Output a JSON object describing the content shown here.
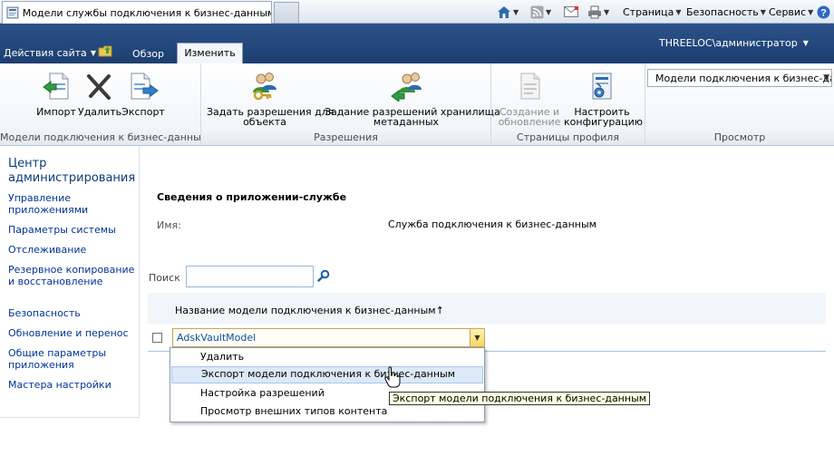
{
  "browser": {
    "tab_title": "Модели службы подключения к бизнес-данным",
    "commands": {
      "page": "Страница",
      "safety": "Безопасность",
      "service": "Сервис"
    }
  },
  "ribbon": {
    "site_actions": "Действия сайта",
    "tabs": {
      "browse": "Обзор",
      "edit": "Изменить"
    },
    "user": "THREELOC\\администратор",
    "groups": {
      "models": {
        "label": "Модели подключения к бизнес-данным",
        "import": "Импорт",
        "delete": "Удалить",
        "export": "Экспорт"
      },
      "permissions": {
        "label": "Разрешения",
        "set_object_line1": "Задать разрешения для",
        "set_object_line2": "объекта",
        "set_store_line1": "Задание разрешений хранилища",
        "set_store_line2": "метаданных"
      },
      "profile_pages": {
        "label": "Страницы профиля",
        "create_line1": "Создание и",
        "create_line2": "обновление",
        "configure_line1": "Настроить",
        "configure_line2": "конфигурацию"
      },
      "view": {
        "label": "Просмотр",
        "selected": "Модели подключения к бизнес-да"
      }
    }
  },
  "leftnav": {
    "title": "Центр администрирования",
    "items": [
      "Управление приложениями",
      "Параметры системы",
      "Отслеживание",
      "Резервное копирование и восстановление",
      "Безопасность",
      "Обновление и перенос",
      "Общие параметры приложения",
      "Мастера настройки"
    ]
  },
  "main": {
    "section_title": "Сведения о приложении-службе",
    "name_label": "Имя:",
    "name_value": "Служба подключения к бизнес-данным",
    "search_label": "Поиск",
    "search_value": "",
    "column_header": "Название модели подключения к бизнес-данным",
    "sort_indicator": "↑",
    "row_item": "AdskVaultModel"
  },
  "context_menu": {
    "items": [
      "Удалить",
      "Экспорт модели подключения к бизнес-данным",
      "Настройка разрешений",
      "Просмотр внешних типов контента"
    ],
    "highlighted_index": 1
  },
  "tooltip": "Экспорт модели подключения к бизнес-данным",
  "colors": {
    "ribbon_band": "#1d3f70",
    "link": "#003399",
    "menu_highlight": "#dce9f8"
  }
}
